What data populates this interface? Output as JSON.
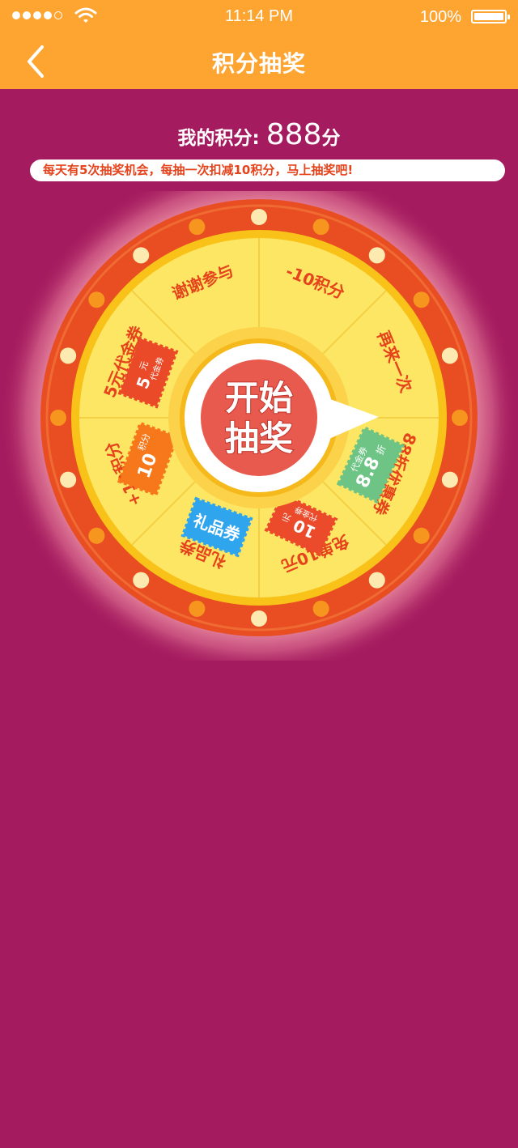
{
  "status_bar": {
    "time": "11:14 PM",
    "battery": "100%",
    "signal_icon": "signal-dots-icon",
    "wifi_icon": "wifi-icon",
    "battery_icon": "battery-icon"
  },
  "header": {
    "back_icon": "chevron-left-icon",
    "title": "积分抽奖"
  },
  "points": {
    "label": "我的积分:",
    "value": "888",
    "unit": "分"
  },
  "notice": "每天有5次抽奖机会，每抽一次扣减10积分，马上抽奖吧!",
  "wheel": {
    "button_line1": "开始",
    "button_line2": "抽奖",
    "segments": [
      {
        "label": "-10积分"
      },
      {
        "label": "再来一次"
      },
      {
        "label": "88折优惠券"
      },
      {
        "label": "免单10元"
      },
      {
        "label": "礼品券"
      },
      {
        "label": "+10积分"
      },
      {
        "label": "5元代金券"
      },
      {
        "label": "谢谢参与"
      }
    ],
    "tickets": {
      "88": {
        "big": "8.8",
        "small": "折",
        "sub": "代金券"
      },
      "free10": {
        "big": "10",
        "small": "元",
        "sub": "代金券"
      },
      "gift": {
        "big": "礼品券"
      },
      "plus10": {
        "big": "10",
        "small": "积分"
      },
      "five": {
        "big": "5",
        "small": "元",
        "sub": "代金券"
      }
    }
  },
  "colors": {
    "background": "#a51b5f",
    "header": "#fda431",
    "ring": "#e94e22",
    "wheel_face": "#fde664",
    "accent_text": "#e4431c",
    "button": "#e85a4e"
  }
}
